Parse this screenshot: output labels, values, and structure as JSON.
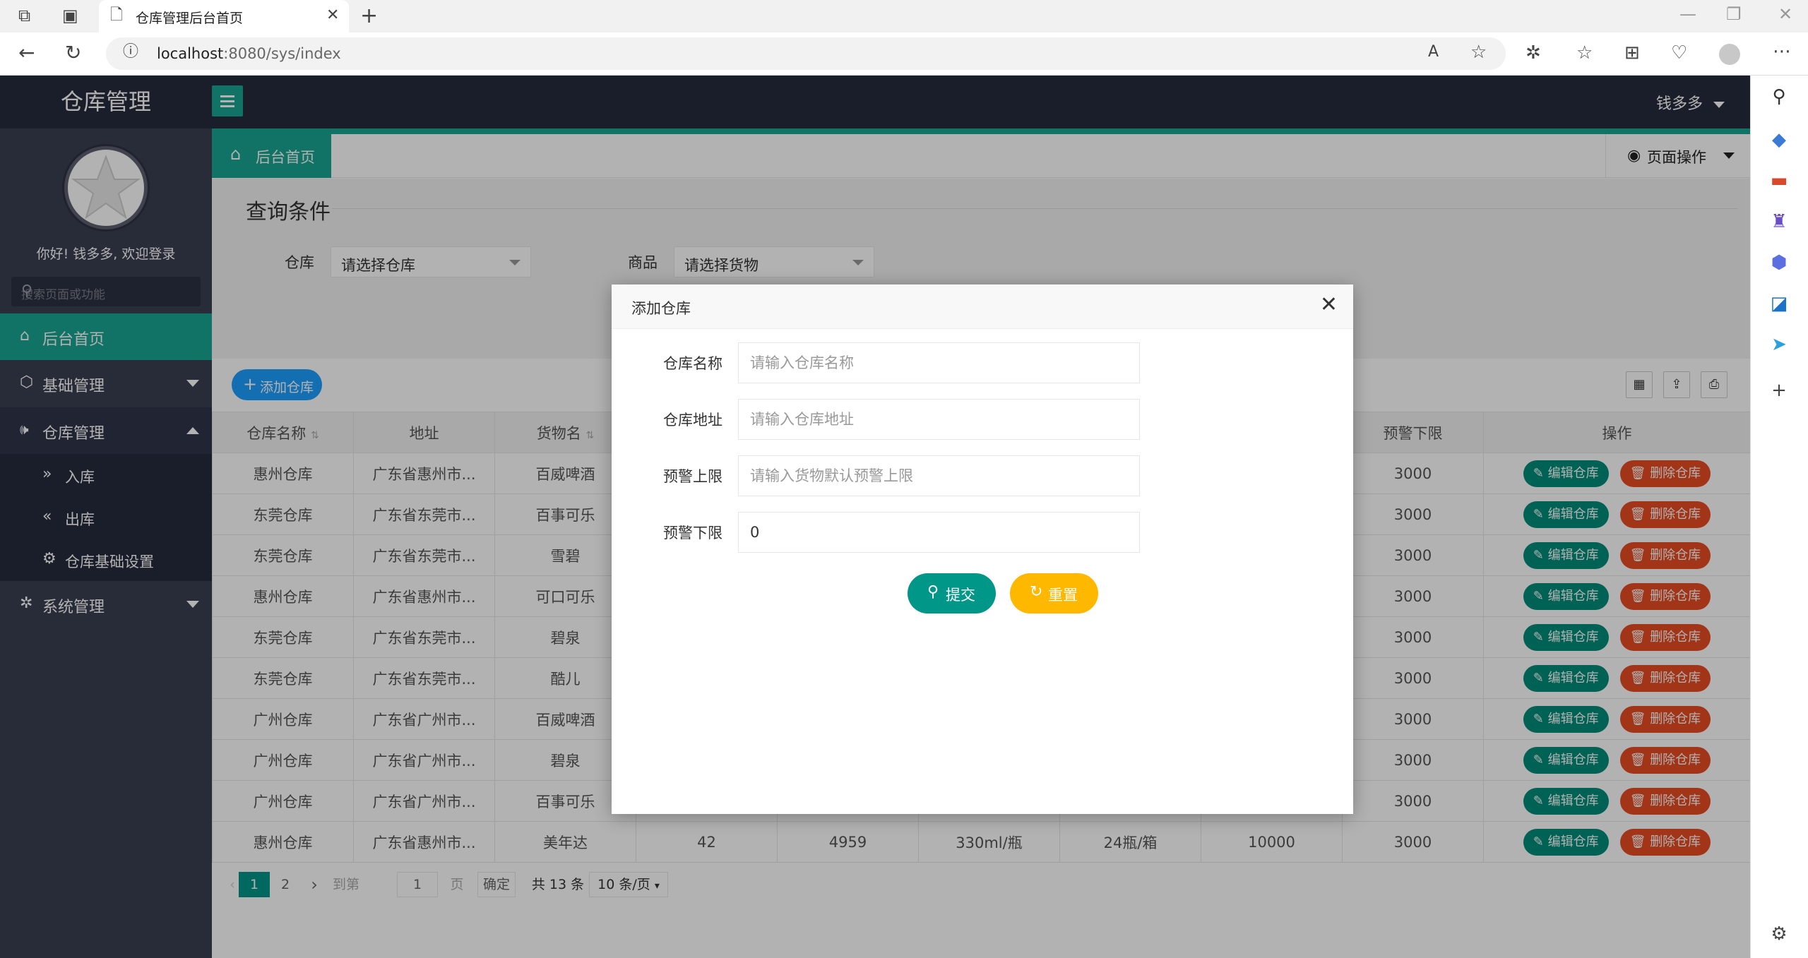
{
  "browser": {
    "tab_title": "仓库管理后台首页",
    "url_host": "localhost",
    "url_rest": ":8080/sys/index"
  },
  "app": {
    "logo": "仓库管理",
    "user_name": "钱多多"
  },
  "sidebar": {
    "welcome": "你好! 钱多多, 欢迎登录",
    "search_placeholder": "搜索页面或功能",
    "items": [
      {
        "label": "后台首页",
        "icon": "home-icon",
        "active": true
      },
      {
        "label": "基础管理",
        "icon": "cube-icon",
        "expanded": false
      },
      {
        "label": "仓库管理",
        "icon": "speaker-icon",
        "expanded": true,
        "children": [
          {
            "label": "入库",
            "icon": "double-right-icon"
          },
          {
            "label": "出库",
            "icon": "double-left-icon"
          },
          {
            "label": "仓库基础设置",
            "icon": "gear-icon"
          }
        ]
      },
      {
        "label": "系统管理",
        "icon": "settings-icon",
        "expanded": false
      }
    ]
  },
  "page_tabs": {
    "home": "后台首页",
    "page_ops": "页面操作"
  },
  "query": {
    "title": "查询条件",
    "warehouse_label": "仓库",
    "warehouse_value": "请选择仓库",
    "goods_label": "商品",
    "goods_value": "请选择货物"
  },
  "table": {
    "add_button": "添加仓库",
    "columns": [
      "仓库名称",
      "地址",
      "货物名",
      "",
      "",
      "",
      "",
      "",
      "预警下限",
      "操作"
    ],
    "edit_label": "编辑仓库",
    "delete_label": "删除仓库",
    "rows": [
      [
        "惠州仓库",
        "广东省惠州市...",
        "百威啤酒",
        "",
        "",
        "",
        "",
        "",
        "3000"
      ],
      [
        "东莞仓库",
        "广东省东莞市...",
        "百事可乐",
        "",
        "",
        "",
        "",
        "",
        "3000"
      ],
      [
        "东莞仓库",
        "广东省东莞市...",
        "雪碧",
        "",
        "",
        "",
        "",
        "",
        "3000"
      ],
      [
        "惠州仓库",
        "广东省惠州市...",
        "可口可乐",
        "",
        "",
        "",
        "",
        "",
        "3000"
      ],
      [
        "东莞仓库",
        "广东省东莞市...",
        "碧泉",
        "",
        "",
        "",
        "",
        "",
        "3000"
      ],
      [
        "东莞仓库",
        "广东省东莞市...",
        "酷儿",
        "",
        "",
        "",
        "",
        "",
        "3000"
      ],
      [
        "广州仓库",
        "广东省广州市...",
        "百威啤酒",
        "",
        "",
        "",
        "",
        "",
        "3000"
      ],
      [
        "广州仓库",
        "广东省广州市...",
        "碧泉",
        "",
        "",
        "",
        "",
        "",
        "3000"
      ],
      [
        "广州仓库",
        "广东省广州市...",
        "百事可乐",
        "",
        "",
        "",
        "",
        "",
        "3000"
      ],
      [
        "惠州仓库",
        "广东省惠州市...",
        "美年达",
        "42",
        "4959",
        "330ml/瓶",
        "24瓶/箱",
        "10000",
        "3000"
      ]
    ]
  },
  "pager": {
    "current": "1",
    "next": "2",
    "goto_label": "到第",
    "goto_value": "1",
    "page_label": "页",
    "confirm": "确定",
    "total": "共 13 条",
    "page_size": "10 条/页"
  },
  "modal": {
    "title": "添加仓库",
    "fields": [
      {
        "label": "仓库名称",
        "placeholder": "请输入仓库名称",
        "value": ""
      },
      {
        "label": "仓库地址",
        "placeholder": "请输入仓库地址",
        "value": ""
      },
      {
        "label": "预警上限",
        "placeholder": "请输入货物默认预警上限",
        "value": ""
      },
      {
        "label": "预警下限",
        "placeholder": "",
        "value": "0"
      }
    ],
    "submit": "提交",
    "reset": "重置"
  },
  "colors": {
    "header": "#262c3d",
    "sidebar": "#3a3f51",
    "accent": "#17a593",
    "submit": "#009688",
    "reset": "#ffb800",
    "edit": "#008c7a",
    "delete": "#e84c22",
    "add": "#1e9fff"
  }
}
